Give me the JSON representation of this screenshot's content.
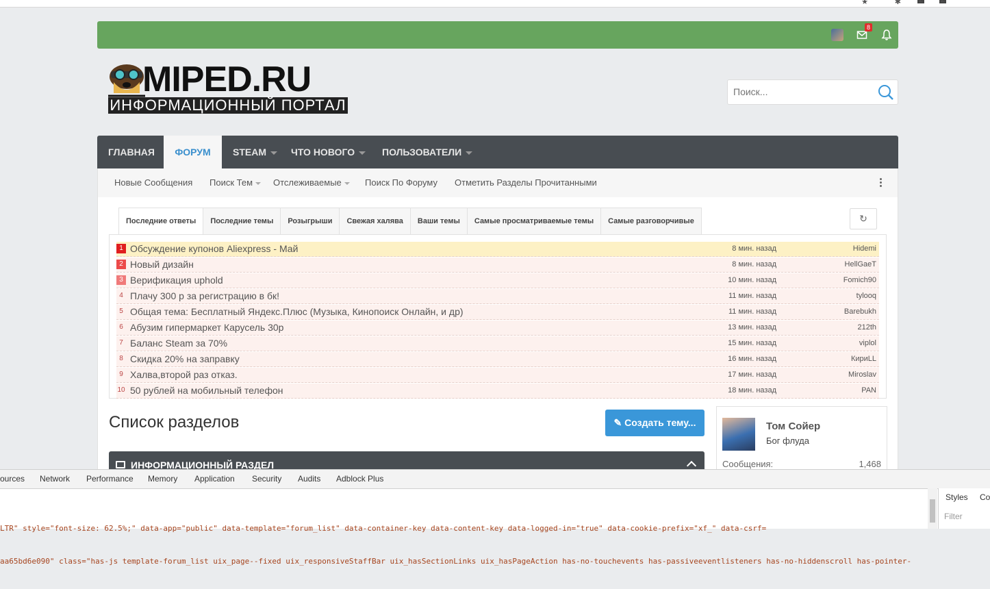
{
  "topbar": {
    "mail_badge": "8"
  },
  "logo": {
    "title": "MIPED.RU",
    "subtitle": "ИНФОРМАЦИОННЫЙ ПОРТАЛ"
  },
  "search": {
    "placeholder": "Поиск..."
  },
  "nav": {
    "items": [
      {
        "label": "ГЛАВНАЯ"
      },
      {
        "label": "ФОРУМ"
      },
      {
        "label": "STEAM"
      },
      {
        "label": "ЧТО НОВОГО"
      },
      {
        "label": "ПОЛЬЗОВАТЕЛИ"
      }
    ]
  },
  "subnav": {
    "items": [
      {
        "label": "Новые Сообщения"
      },
      {
        "label": "Поиск Тем"
      },
      {
        "label": "Отслеживаемые"
      },
      {
        "label": "Поиск По Форуму"
      },
      {
        "label": "Отметить Разделы Прочитанными"
      }
    ]
  },
  "tabs": [
    {
      "label": "Последние ответы"
    },
    {
      "label": "Последние темы"
    },
    {
      "label": "Розыгрыши"
    },
    {
      "label": "Свежая халява"
    },
    {
      "label": "Ваши темы"
    },
    {
      "label": "Самые просматриваемые темы"
    },
    {
      "label": "Самые разговорчивые"
    }
  ],
  "topics": [
    {
      "num": "1",
      "title": "Обсуждение купонов Aliexpress - Май",
      "time": "8 мин. назад",
      "user": "Hidemi"
    },
    {
      "num": "2",
      "title": "Новый дизайн",
      "time": "8 мин. назад",
      "user": "HellGaeT"
    },
    {
      "num": "3",
      "title": "Верификация uphold",
      "time": "10 мин. назад",
      "user": "Fomich90"
    },
    {
      "num": "4",
      "title": "Плачу 300 р за регистрацию в бк!",
      "time": "11 мин. назад",
      "user": "tylooq"
    },
    {
      "num": "5",
      "title": "Общая тема: Бесплатный Яндекс.Плюс (Музыка, Кинопоиск Онлайн, и др)",
      "time": "11 мин. назад",
      "user": "Barebukh"
    },
    {
      "num": "6",
      "title": "Абузим гипермаркет Карусель 30р",
      "time": "13 мин. назад",
      "user": "212th"
    },
    {
      "num": "7",
      "title": "Баланс Steam за 70%",
      "time": "15 мин. назад",
      "user": "viplol"
    },
    {
      "num": "8",
      "title": "Скидка 20% на заправку",
      "time": "16 мин. назад",
      "user": "КириLL"
    },
    {
      "num": "9",
      "title": "Халва,второй раз отказ.",
      "time": "17 мин. назад",
      "user": "Miroslav"
    },
    {
      "num": "10",
      "title": "50 рублей на мобильный телефон",
      "time": "18 мин. назад",
      "user": "PAN"
    }
  ],
  "main": {
    "sections_title": "Список разделов",
    "create_label": "Создать тему...",
    "section_label": "ИНФОРМАЦИОННЫЙ РАЗДЕЛ"
  },
  "profile": {
    "name": "Том Сойер",
    "rank": "Бог флуда",
    "stat_label": "Сообщения:",
    "stat_value": "1,468"
  },
  "devtools": {
    "tabs": [
      "ources",
      "Network",
      "Performance",
      "Memory",
      "Application",
      "Security",
      "Audits",
      "Adblock Plus"
    ],
    "styles_tab": "Styles",
    "computed_tab": "Co",
    "filter_placeholder": "Filter",
    "code_line1": "LTR\" style=\"font-size: 62.5%;\" data-app=\"public\" data-template=\"forum_list\" data-container-key data-content-key data-logged-in=\"true\" data-cookie-prefix=\"xf_\" data-csrf=",
    "code_line2": "aa65bd6e090\" class=\"has-js template-forum_list uix_page--fixed uix_responsiveStaffBar uix_hasSectionLinks uix_hasPageAction has-no-touchevents has-passiveeventlisteners has-no-hiddenscroll has-pointer-"
  },
  "colors": {
    "topbar_green": "#67a55e",
    "nav_dark": "#484d52",
    "accent_blue": "#3a97d9",
    "active_nav_text": "#3a8fcd"
  }
}
